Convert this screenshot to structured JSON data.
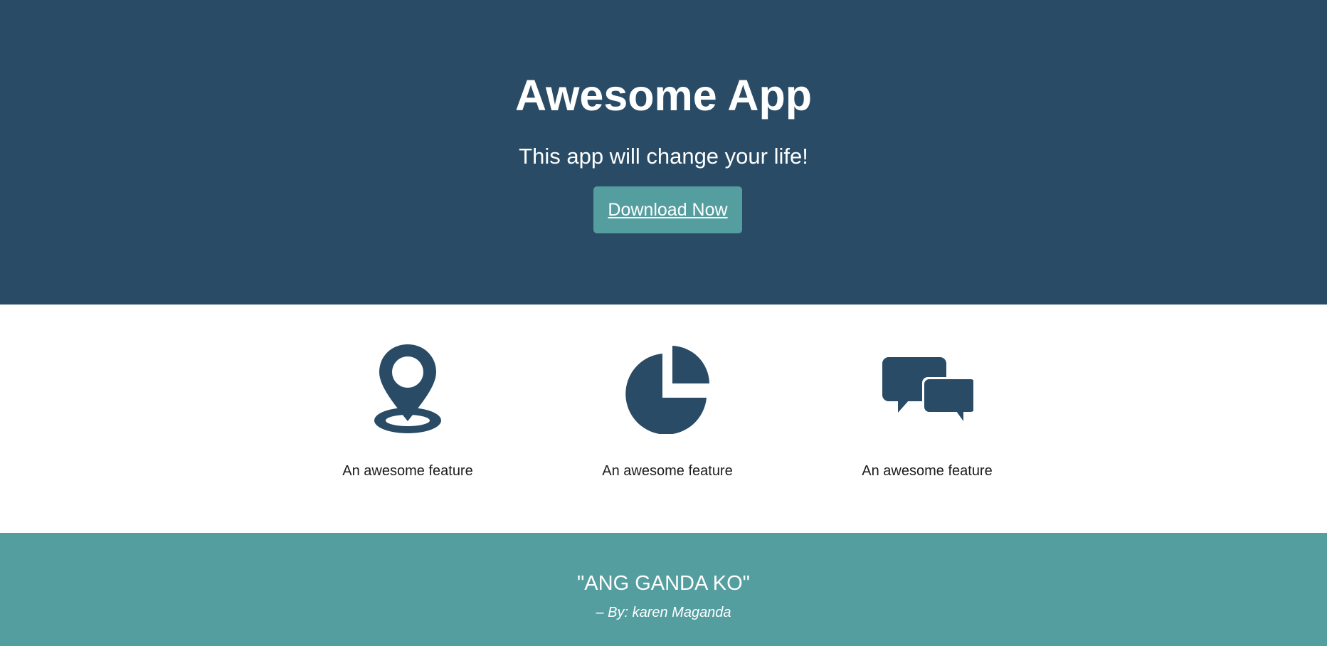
{
  "hero": {
    "title": "Awesome App",
    "subtitle": "This app will change your life!",
    "download_label": "Download Now"
  },
  "features": [
    {
      "icon": "map-marker-icon",
      "label": "An awesome feature"
    },
    {
      "icon": "pie-chart-icon",
      "label": "An awesome feature"
    },
    {
      "icon": "chat-bubbles-icon",
      "label": "An awesome feature"
    }
  ],
  "quote": {
    "text": "\"ANG GANDA KO\"",
    "author": "– By: karen Maganda"
  },
  "colors": {
    "hero_bg": "#294b65",
    "accent": "#549ea0",
    "icon": "#294b65"
  }
}
